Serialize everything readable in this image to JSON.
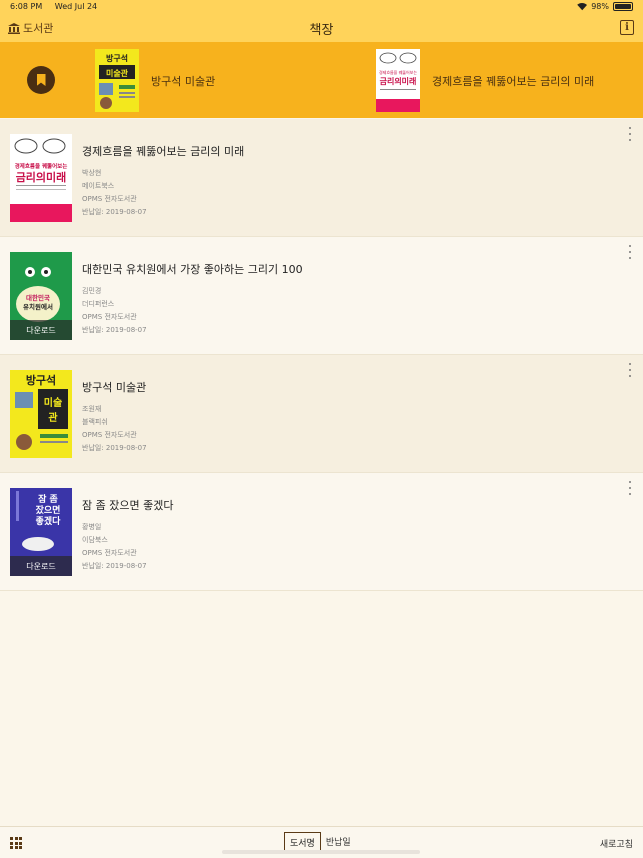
{
  "status_bar": {
    "time": "6:08 PM",
    "date": "Wed Jul 24",
    "battery": "98%",
    "battery_level": 0.98
  },
  "nav": {
    "back_label": "도서관",
    "title": "책장",
    "info_icon": "info-icon"
  },
  "recent": [
    {
      "title": "방구석 미술관"
    },
    {
      "title": "경제흐름을 꿰뚫어보는 금리의 미래"
    }
  ],
  "covers": {
    "c1": {
      "top": "경제흐름을 꿰뚫어보는",
      "main": "금리의미래"
    },
    "c2": {
      "main": "대한민국 유치원에서 가장 좋아하는"
    },
    "c3": {
      "main": "방구석 미술관"
    },
    "c4": {
      "main": "잠 좀 잤으면 좋겠다"
    }
  },
  "books": [
    {
      "title": "경제흐름을 꿰뚫어보는 금리의 미래",
      "author": "박상현",
      "publisher": "메이트북스",
      "library": "OPMS 전자도서관",
      "return_date": "반납일: 2019-08-07",
      "overlay": ""
    },
    {
      "title": "대한민국 유치원에서 가장 좋아하는 그리기 100",
      "author": "김민경",
      "publisher": "더디퍼런스",
      "library": "OPMS 전자도서관",
      "return_date": "반납일: 2019-08-07",
      "overlay": "다운로드"
    },
    {
      "title": "방구석 미술관",
      "author": "조원재",
      "publisher": "블랙피쉬",
      "library": "OPMS 전자도서관",
      "return_date": "반납일: 2019-08-07",
      "overlay": ""
    },
    {
      "title": "잠 좀 잤으면 좋겠다",
      "author": "황병일",
      "publisher": "이담북스",
      "library": "OPMS 전자도서관",
      "return_date": "반납일: 2019-08-07",
      "overlay": "다운로드"
    }
  ],
  "bottom": {
    "sort_by_title": "도서명",
    "sort_by_return": "반납일",
    "refresh": "새로고침"
  },
  "colors": {
    "header": "#ffd35a",
    "recent_strip": "#f7b21d",
    "accent": "#5a3a16"
  }
}
